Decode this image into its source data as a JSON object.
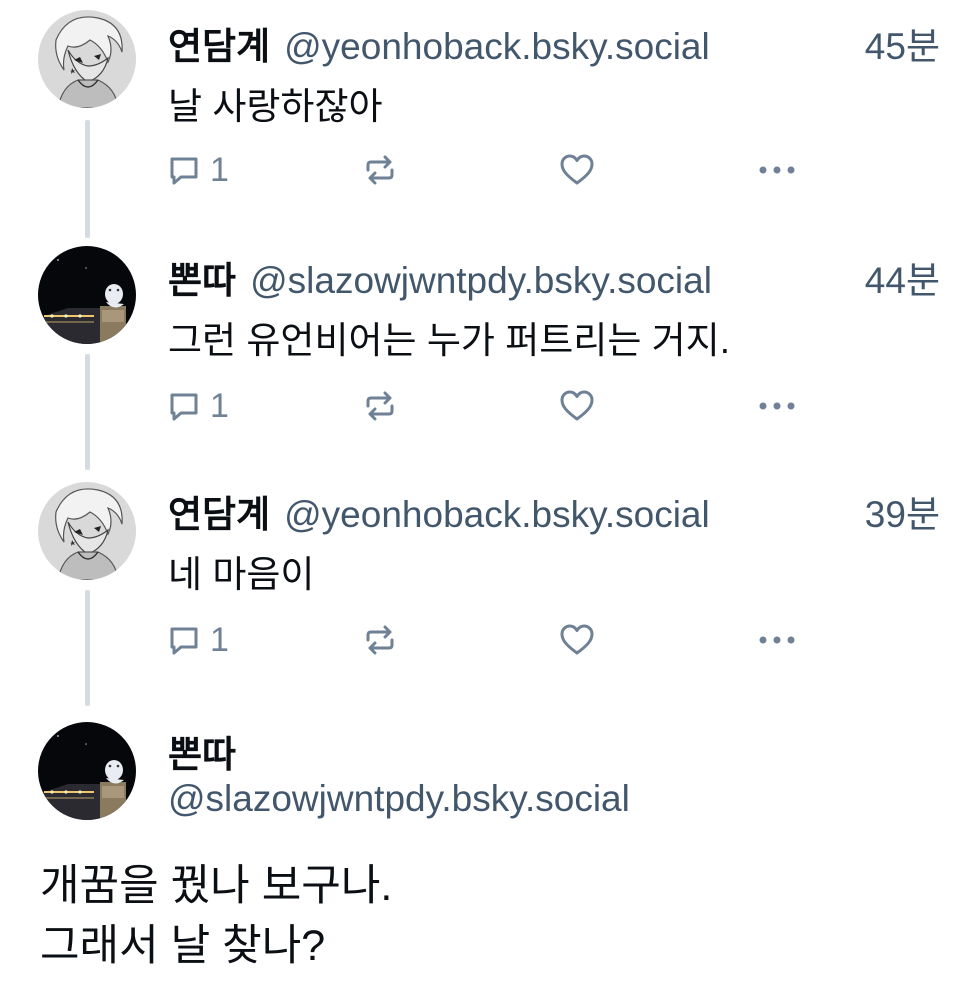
{
  "thread": [
    {
      "name": "연담계",
      "handle": "@yeonhoback.bsky.social",
      "time": "45분",
      "text": "날 사랑하잖아",
      "reply_count": "1",
      "avatar": "white-haired-character-avatar"
    },
    {
      "name": "뽄따",
      "handle": "@slazowjwntpdy.bsky.social",
      "time": "44분",
      "text": "그런 유언비어는 누가 퍼트리는 거지.",
      "reply_count": "1",
      "avatar": "night-building-avatar"
    },
    {
      "name": "연담계",
      "handle": "@yeonhoback.bsky.social",
      "time": "39분",
      "text": "네 마음이",
      "reply_count": "1",
      "avatar": "white-haired-character-avatar"
    }
  ],
  "main_post": {
    "name": "뽄따",
    "handle": "@slazowjwntpdy.bsky.social",
    "text_line1": "개꿈을 꿨나 보구나.",
    "text_line2": "그래서 날 찾나?",
    "avatar": "night-building-avatar"
  },
  "icons": {
    "reply": "reply-icon",
    "repost": "repost-icon",
    "like": "heart-icon",
    "more": "more-options-icon"
  },
  "colors": {
    "text": "#0b0f14",
    "muted": "#42576c",
    "icon": "#6f8194",
    "thread_line": "#d4dbe2"
  }
}
